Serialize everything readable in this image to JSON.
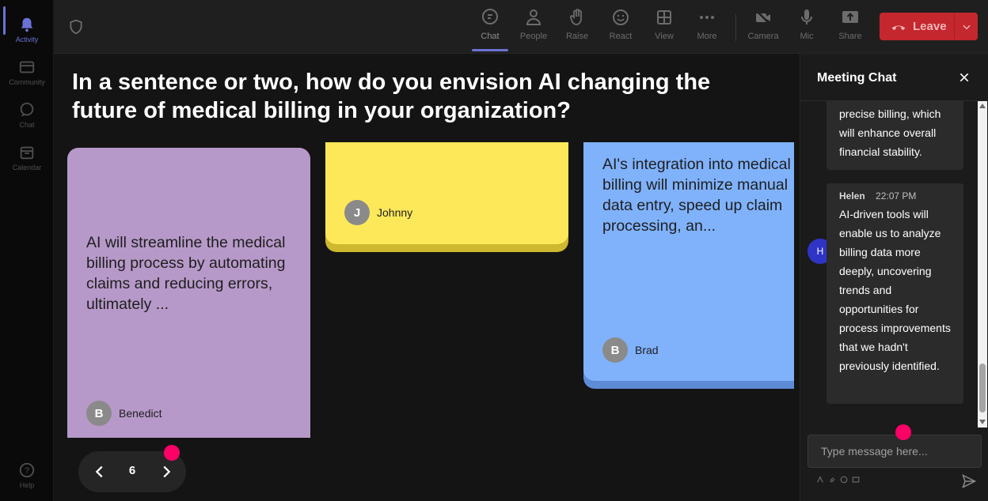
{
  "rail": {
    "items": [
      {
        "label": "Activity",
        "icon": "bell-icon"
      },
      {
        "label": "Community",
        "icon": "community-icon"
      },
      {
        "label": "Chat",
        "icon": "chat-icon"
      },
      {
        "label": "Calendar",
        "icon": "calendar-icon"
      },
      {
        "label": "Help",
        "icon": "help-icon"
      }
    ]
  },
  "toolbar": {
    "items": [
      {
        "label": "Chat",
        "icon": "chat-icon"
      },
      {
        "label": "People",
        "icon": "people-icon"
      },
      {
        "label": "Raise",
        "icon": "hand-icon"
      },
      {
        "label": "React",
        "icon": "smiley-icon"
      },
      {
        "label": "View",
        "icon": "grid-icon"
      },
      {
        "label": "More",
        "icon": "more-icon"
      },
      {
        "label": "Camera",
        "icon": "camera-off-icon"
      },
      {
        "label": "Mic",
        "icon": "mic-icon"
      },
      {
        "label": "Share",
        "icon": "share-icon"
      }
    ],
    "leave_label": "Leave"
  },
  "question": "In a sentence or two, how do you envision AI changing the future of medical billing in your organization?",
  "cards": [
    {
      "text": "AI will streamline the medical billing process by automating claims and reducing errors, ultimately ...",
      "author": "Benedict",
      "initial": "B",
      "color": "#b799c9"
    },
    {
      "text": "",
      "author": "Johnny",
      "initial": "J",
      "color": "#fde85a"
    },
    {
      "text": "AI's integration into medical billing will minimize manual data entry, speed up claim processing, an...",
      "author": "Brad",
      "initial": "B",
      "color": "#80b2fc"
    }
  ],
  "pager": {
    "page": "6"
  },
  "chat": {
    "title": "Meeting Chat",
    "messages": [
      {
        "text": "precise billing, which will enhance overall financial stability."
      },
      {
        "name": "Helen",
        "time": "22:07 PM",
        "initial": "H",
        "text": "AI-driven tools will enable us to analyze billing data more deeply, uncovering trends and opportunities for process improvements that we hadn't previously identified."
      }
    ],
    "input_placeholder": "Type message here..."
  },
  "colors": {
    "accent": "#6b72d6",
    "leave": "#c4272e",
    "marker": "#ff0066"
  }
}
